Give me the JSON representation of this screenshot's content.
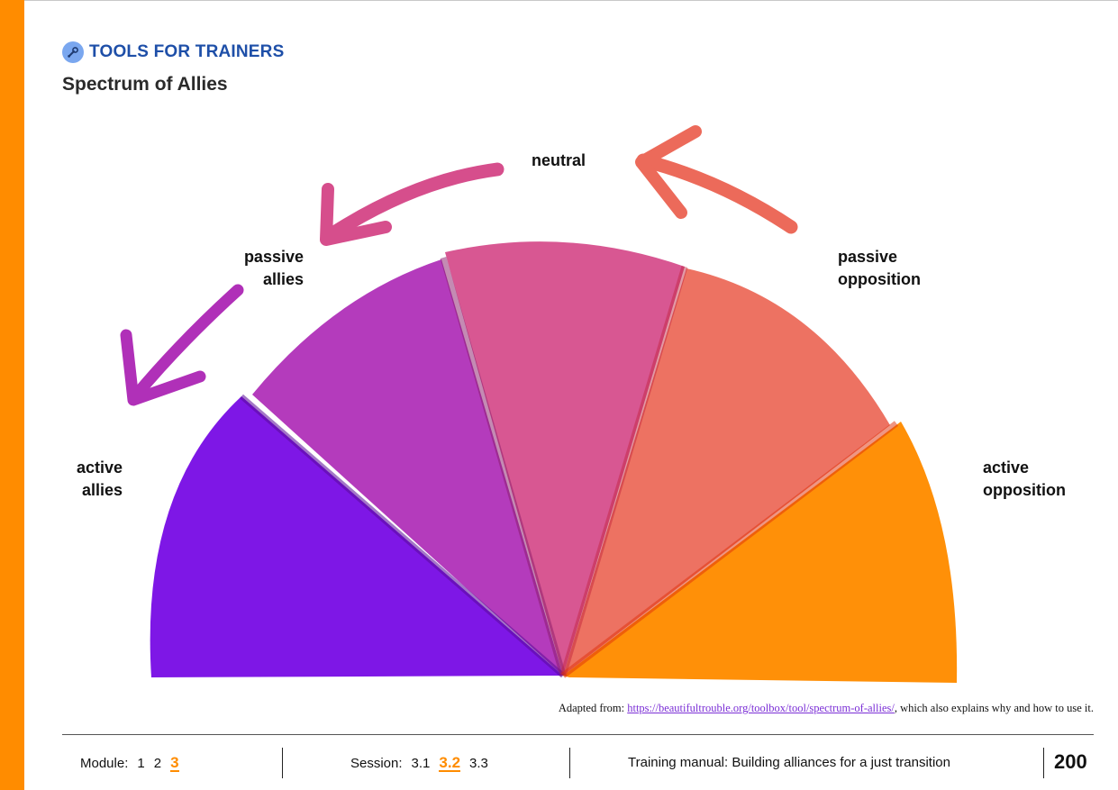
{
  "header": {
    "kicker": "TOOLS FOR TRAINERS",
    "kicker_icon": "wrench-icon",
    "title": "Spectrum of Allies"
  },
  "diagram": {
    "segments": [
      {
        "id": "active-allies",
        "label_lines": [
          "active",
          "allies"
        ],
        "color": "#7b12e6"
      },
      {
        "id": "passive-allies",
        "label_lines": [
          "passive",
          "allies"
        ],
        "color": "#b030b8"
      },
      {
        "id": "neutral",
        "label_lines": [
          "neutral"
        ],
        "color": "#d64e8c"
      },
      {
        "id": "passive-opposition",
        "label_lines": [
          "passive",
          "opposition"
        ],
        "color": "#ec6a5a"
      },
      {
        "id": "active-opposition",
        "label_lines": [
          "active",
          "opposition"
        ],
        "color": "#ff8c00"
      }
    ]
  },
  "credit": {
    "prefix": "Adapted from: ",
    "link": "https://beautifultrouble.org/toolbox/tool/spectrum-of-allies/",
    "suffix": ", which also explains why and how to use it."
  },
  "footer": {
    "module_label": "Module:",
    "modules": [
      "1",
      "2"
    ],
    "module_current": "3",
    "session_label": "Session:",
    "session_before": "3.1",
    "session_current": "3.2",
    "session_after": "3.3",
    "manual_title": "Training manual: Building alliances for a just transition",
    "page_number": "200"
  },
  "colors": {
    "accent": "#ff8c00",
    "kicker": "#1e4fa8",
    "link": "#7b2fd6"
  }
}
